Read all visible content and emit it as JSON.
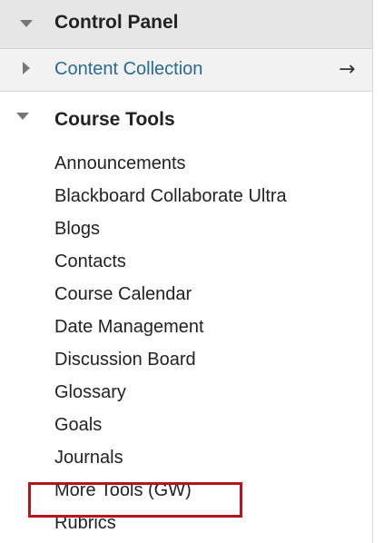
{
  "control_panel": {
    "title": "Control Panel"
  },
  "content_collection": {
    "label": "Content Collection",
    "arrow": "→"
  },
  "course_tools": {
    "title": "Course Tools",
    "items": [
      "Announcements",
      "Blackboard Collaborate Ultra",
      "Blogs",
      "Contacts",
      "Course Calendar",
      "Date Management",
      "Discussion Board",
      "Glossary",
      "Goals",
      "Journals",
      "More Tools (GW)",
      "Rubrics"
    ],
    "highlighted_item": "More Tools (GW)"
  },
  "colors": {
    "header_bg": "#e6e6e6",
    "link": "#2a6a8e",
    "highlight_border": "#b3151b"
  }
}
